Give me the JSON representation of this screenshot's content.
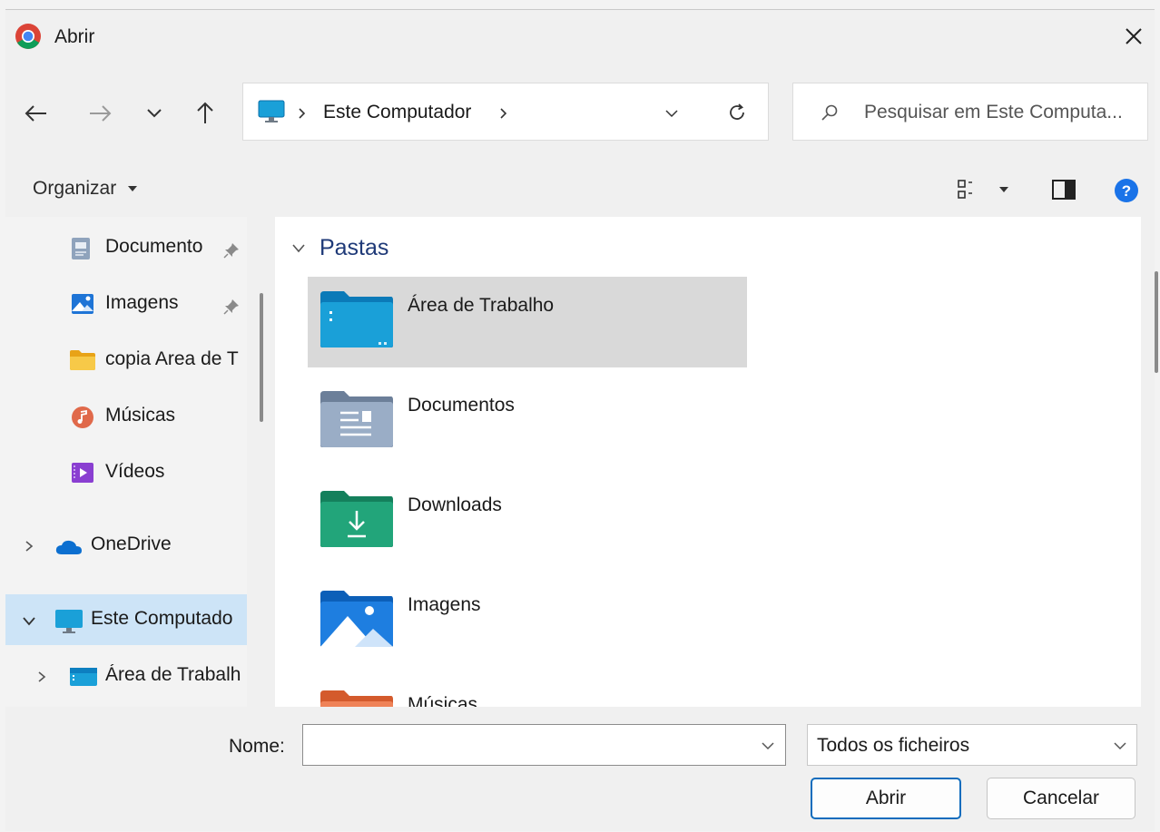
{
  "window": {
    "title": "Abrir"
  },
  "address": {
    "crumbs": [
      "Este Computador"
    ]
  },
  "search": {
    "placeholder": "Pesquisar em Este Computa..."
  },
  "toolbar": {
    "organize_label": "Organizar"
  },
  "sidebar": {
    "items": [
      {
        "label": "Documento",
        "icon": "document-icon",
        "pinned": true
      },
      {
        "label": "Imagens",
        "icon": "pictures-icon",
        "pinned": true
      },
      {
        "label": "copia Area de T",
        "icon": "folder-icon",
        "pinned": false
      },
      {
        "label": "Músicas",
        "icon": "music-icon",
        "pinned": false
      },
      {
        "label": "Vídeos",
        "icon": "videos-icon",
        "pinned": false
      },
      {
        "label": "OneDrive",
        "icon": "onedrive-icon",
        "expandable": true
      },
      {
        "label": "Este Computado",
        "icon": "computer-icon",
        "expanded": true,
        "selected": true
      },
      {
        "label": "Área de Trabalh",
        "icon": "desktop-folder-icon",
        "expandable": true
      }
    ]
  },
  "content": {
    "group_label": "Pastas",
    "folders": [
      {
        "name": "Área de Trabalho",
        "icon": "desktop-folder-icon",
        "selected": true
      },
      {
        "name": "Documentos",
        "icon": "documents-folder-icon"
      },
      {
        "name": "Downloads",
        "icon": "downloads-folder-icon"
      },
      {
        "name": "Imagens",
        "icon": "pictures-folder-icon"
      },
      {
        "name": "Músicas",
        "icon": "music-folder-icon"
      }
    ]
  },
  "footer": {
    "name_label": "Nome:",
    "name_value": "",
    "filter_value": "Todos os ficheiros",
    "open_label": "Abrir",
    "cancel_label": "Cancelar"
  },
  "colors": {
    "accent": "#0f6cbd",
    "selection": "#d9d9d9",
    "help": "#1a73e8"
  }
}
